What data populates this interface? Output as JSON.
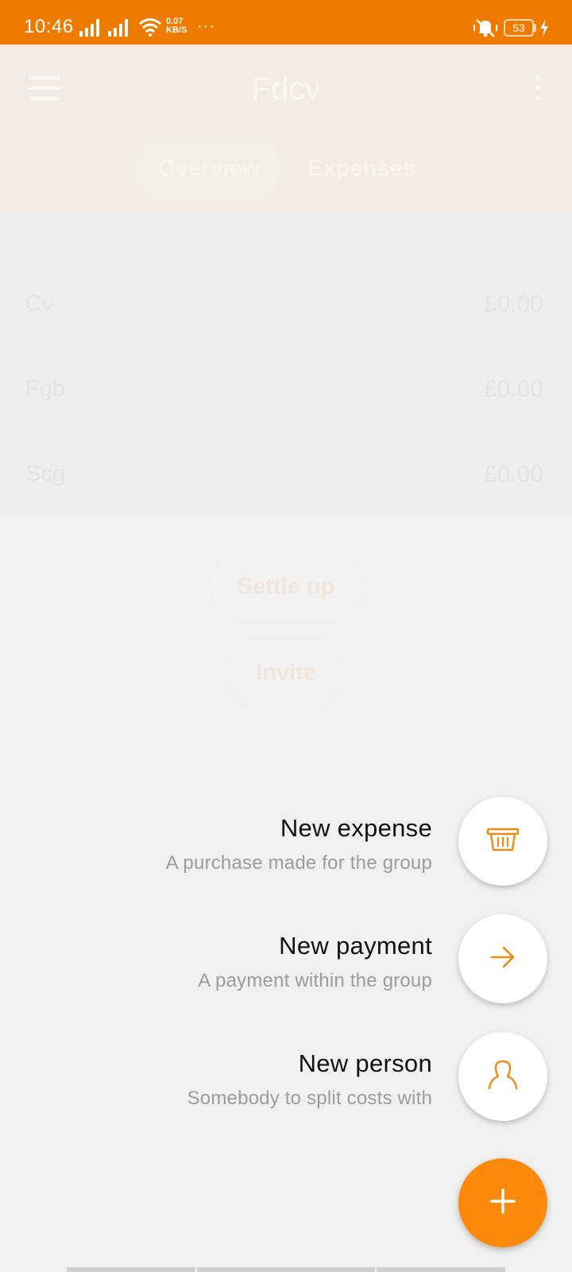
{
  "status": {
    "time": "10:46",
    "speed_value": "0.07",
    "speed_unit": "KB/S",
    "overflow": "···",
    "battery": "53"
  },
  "header": {
    "title": "Fdcv",
    "tabs": [
      {
        "label": "Overview",
        "selected": true
      },
      {
        "label": "Expenses",
        "selected": false
      }
    ]
  },
  "balances": [
    {
      "name": "Cv",
      "amount": "£0.00"
    },
    {
      "name": "Fgb",
      "amount": "£0.00"
    },
    {
      "name": "Scg",
      "amount": "£0.00"
    }
  ],
  "actions": {
    "settle_up": "Settle up",
    "invite": "Invite"
  },
  "speed_dial": [
    {
      "title": "New expense",
      "subtitle": "A purchase made for the group",
      "icon": "basket-icon"
    },
    {
      "title": "New payment",
      "subtitle": "A payment within the group",
      "icon": "arrow-right-icon"
    },
    {
      "title": "New person",
      "subtitle": "Somebody to split costs with",
      "icon": "person-icon"
    }
  ],
  "fab": {
    "icon": "plus-icon"
  },
  "colors": {
    "accent": "#fb8a0c",
    "status_bar": "#ee7a00",
    "icon": "#f08a16"
  }
}
